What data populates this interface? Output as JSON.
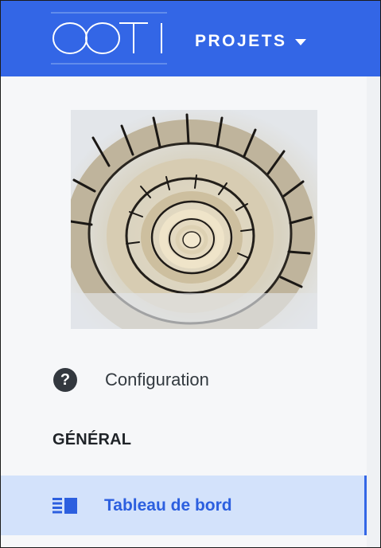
{
  "app": {
    "logo_text": "OOTI",
    "brand_color": "#3366e6"
  },
  "header": {
    "projects_label": "PROJETS",
    "projects_icon": "chevron-down-icon"
  },
  "sidebar": {
    "project_image": "spiral-staircase-photo",
    "config_label": "Configuration",
    "config_icon": "help-circle-icon",
    "section_title": "GÉNÉRAL",
    "items": [
      {
        "label": "Tableau de bord",
        "icon": "dashboard-icon",
        "active": true
      }
    ]
  }
}
